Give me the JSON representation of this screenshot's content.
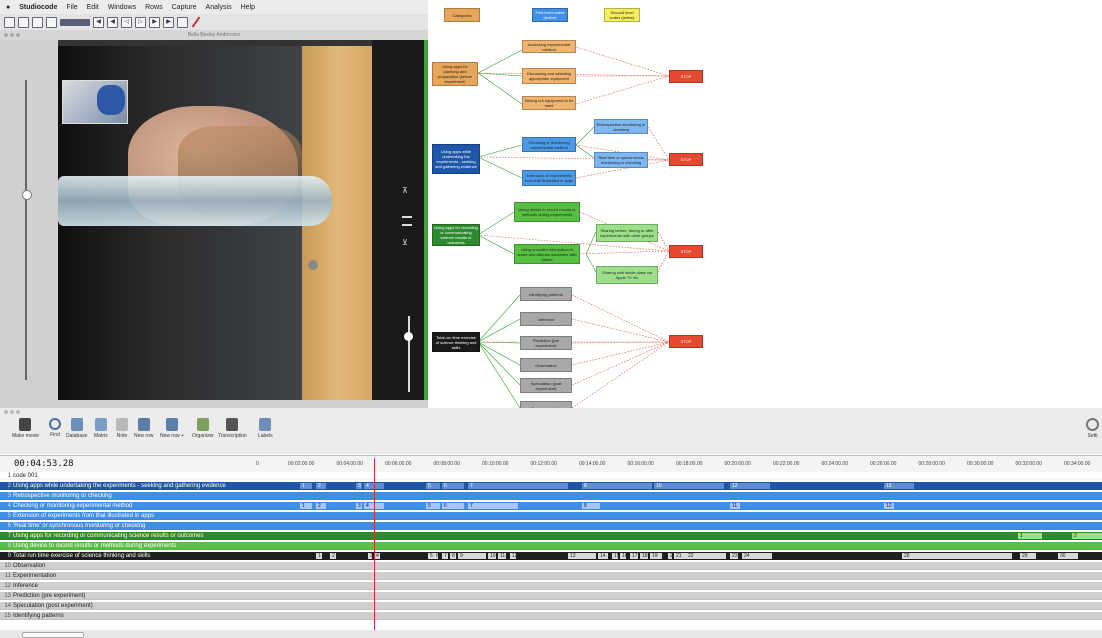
{
  "menubar": {
    "apple": "●",
    "app": "Studiocode",
    "items": [
      "File",
      "Edit",
      "Windows",
      "Rows",
      "Capture",
      "Analysis",
      "Help"
    ]
  },
  "window": {
    "title": "Bella Bexley Ambrosino"
  },
  "legend": {
    "categories": "Categories",
    "first_level": "First level codes (active)",
    "second_level": "Second level codes (active)"
  },
  "diagram": {
    "orange": {
      "main": "Using apps for planning and preparation (before experiment)",
      "subs": [
        "Assessing experimental method",
        "Discussing and selecting appropriate equipment",
        "Setting out equipment to be used"
      ],
      "stop": "STOP"
    },
    "blue": {
      "main": "Using apps while undertaking the experiments - seeking and gathering evidence",
      "subs": [
        "Checking or monitoring experimental method",
        "Extension of experiments from that illustrated in apps"
      ],
      "subs2": [
        "Retrospective monitoring or checking",
        "Real time or synchronous monitoring or checking"
      ],
      "stop": "STOP"
    },
    "green": {
      "main": "Using apps for recording or communicating science results or outcomes",
      "subs": [
        "Using device to record results or methods during experiments",
        "Using recorded information to share and discuss outcomes with others"
      ],
      "subs2": [
        "Sharing before, during or after experiments with other groups",
        "Sharing with whole class via Apple TV etc"
      ],
      "stop": "STOP"
    },
    "grey": {
      "main": "Total run time exercise of science thinking and skills",
      "subs": [
        "Identifying patterns",
        "Inference",
        "Prediction (pre experiment)",
        "Observation",
        "Speculation (post experiment)",
        "Experimentation"
      ],
      "stop": "STOP"
    }
  },
  "toolbar": {
    "buttons": [
      "Make movie",
      "Find",
      "Database",
      "Matrix",
      "Note",
      "New row",
      "New row +",
      "Organizer",
      "Transcription",
      "Labels"
    ],
    "settings": "Setti"
  },
  "timeline": {
    "timecode": "00:04:53.28",
    "ticks": [
      "0",
      "00:02:00.00",
      "00:04:00.00",
      "00:06:00.00",
      "00:08:00.00",
      "00:10:00.00",
      "00:12:00.00",
      "00:14:00.00",
      "00:16:00.00",
      "00:18:00.00",
      "00:20:00.00",
      "00:22:00.00",
      "00:24:00.00",
      "00:26:00.00",
      "00:28:00.00",
      "00:30:00.00",
      "00:32:00.00",
      "00:34:00.00"
    ],
    "rows": [
      {
        "n": "1",
        "label": "code 001",
        "bg": "#ffffff",
        "fg": "#222"
      },
      {
        "n": "2",
        "label": "Using apps while undertaking the experiments - seeking and gathering evidence",
        "bg": "#1f57a8",
        "fg": "#ffffff"
      },
      {
        "n": "3",
        "label": "Retrospective monitoring or checking",
        "bg": "#3f8ee8",
        "fg": "#ffffff"
      },
      {
        "n": "4",
        "label": "Checking or monitoring experimental method",
        "bg": "#3f8ee8",
        "fg": "#ffffff"
      },
      {
        "n": "5",
        "label": "Extension of experiments from that illustrated in apps",
        "bg": "#3f8ee8",
        "fg": "#ffffff"
      },
      {
        "n": "6",
        "label": "'Real time' or synchronous monitoring or checking",
        "bg": "#3f8ee8",
        "fg": "#ffffff"
      },
      {
        "n": "7",
        "label": "Using apps for recording or communicating science results or outcomes",
        "bg": "#2e8a2e",
        "fg": "#ffffff"
      },
      {
        "n": "8",
        "label": "Using device to record results or methods during experiments",
        "bg": "#5bbf45",
        "fg": "#ffffff"
      },
      {
        "n": "9",
        "label": "Total run time exercise of science thinking and skills",
        "bg": "#1f1f1f",
        "fg": "#ffffff"
      },
      {
        "n": "10",
        "label": "Observation",
        "bg": "#cfcfcf",
        "fg": "#222"
      },
      {
        "n": "11",
        "label": "Experimentation",
        "bg": "#cfcfcf",
        "fg": "#222"
      },
      {
        "n": "12",
        "label": "Inference",
        "bg": "#cfcfcf",
        "fg": "#222"
      },
      {
        "n": "13",
        "label": "Prediction (pre experiment)",
        "bg": "#cfcfcf",
        "fg": "#222"
      },
      {
        "n": "14",
        "label": "Speculation (post experiment)",
        "bg": "#cfcfcf",
        "fg": "#222"
      },
      {
        "n": "15",
        "label": "Identifying patterns",
        "bg": "#cfcfcf",
        "fg": "#222"
      }
    ],
    "row2_segs": [
      "1",
      "2",
      "3",
      "4",
      "5",
      "6",
      "7",
      "8",
      "10",
      "12",
      "13"
    ],
    "row4_segs": [
      "1",
      "2",
      "3",
      "4",
      "5",
      "6",
      "7",
      "8",
      "11",
      "12"
    ],
    "row9_segs": [
      "1",
      "2",
      "3",
      "4",
      "5",
      "6",
      "7",
      "8",
      "9",
      "10",
      "11",
      "12",
      "13",
      "14",
      "15",
      "16",
      "17",
      "18",
      "19",
      "20",
      "21",
      "22",
      "23",
      "24",
      "28",
      "29",
      "30"
    ],
    "row7_segs": [
      "1",
      "2"
    ]
  }
}
